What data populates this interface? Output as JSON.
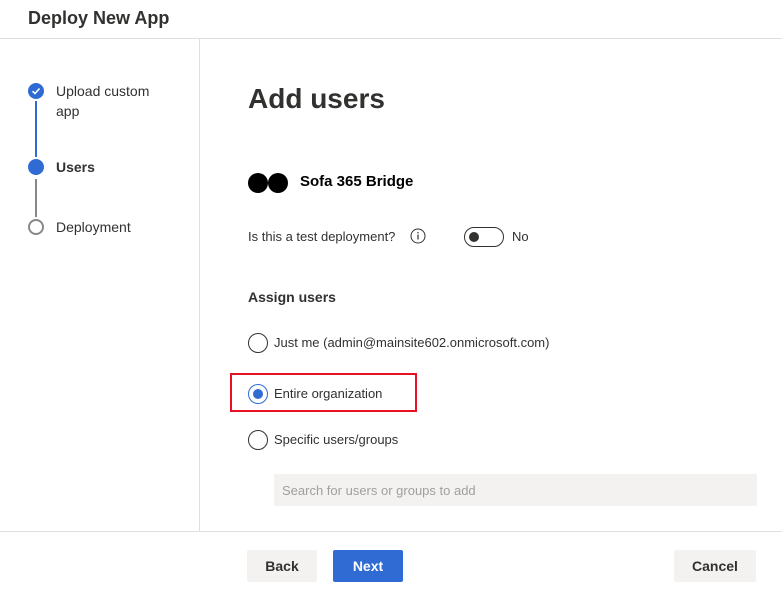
{
  "header": {
    "title": "Deploy New App"
  },
  "steps": [
    {
      "label": "Upload custom app",
      "state": "done"
    },
    {
      "label": "Users",
      "state": "current"
    },
    {
      "label": "Deployment",
      "state": "pending"
    }
  ],
  "main": {
    "title": "Add users",
    "app_name": "Sofa 365 Bridge",
    "test_deployment": {
      "label": "Is this a test deployment?",
      "value_text": "No",
      "enabled": false
    },
    "assign_users": {
      "title": "Assign users",
      "options": [
        {
          "label": "Just me (admin@mainsite602.onmicrosoft.com)",
          "checked": false
        },
        {
          "label": "Entire organization",
          "checked": true
        },
        {
          "label": "Specific users/groups",
          "checked": false
        }
      ]
    },
    "search": {
      "placeholder": "Search for users or groups to add"
    }
  },
  "footer": {
    "back_label": "Back",
    "next_label": "Next",
    "cancel_label": "Cancel"
  },
  "colors": {
    "accent": "#2f6bd2",
    "highlight": "#e81123"
  }
}
